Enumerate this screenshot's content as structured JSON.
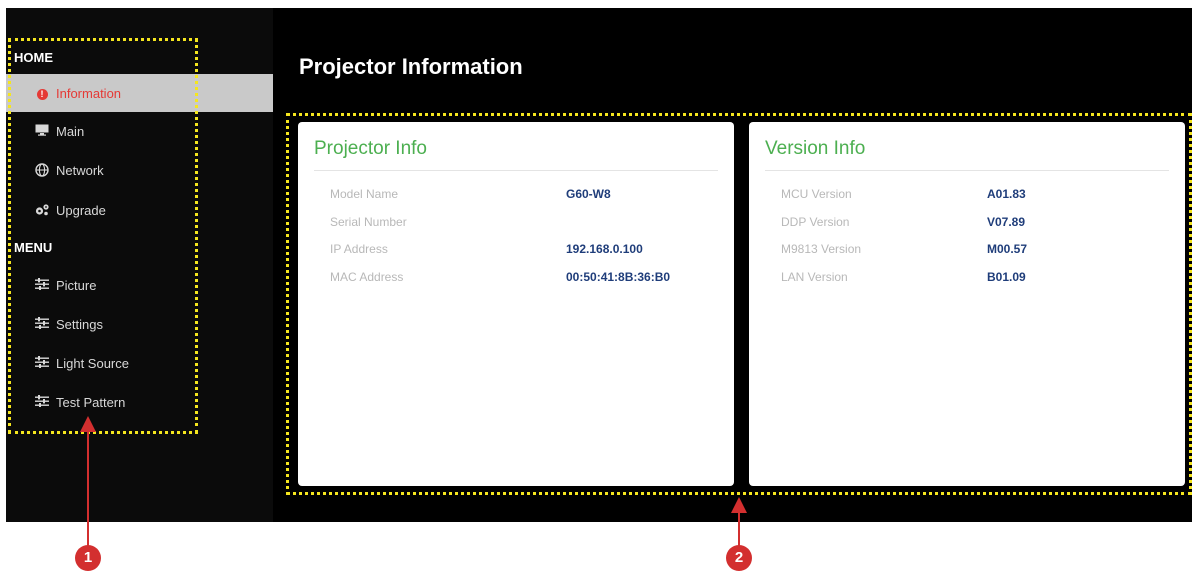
{
  "sidebar": {
    "home_label": "HOME",
    "home_items": [
      {
        "label": "Information",
        "icon": "info-icon",
        "active": true
      },
      {
        "label": "Main",
        "icon": "monitor-icon"
      },
      {
        "label": "Network",
        "icon": "network-icon"
      },
      {
        "label": "Upgrade",
        "icon": "gears-icon"
      }
    ],
    "menu_label": "MENU",
    "menu_items": [
      {
        "label": "Picture",
        "icon": "sliders-icon"
      },
      {
        "label": "Settings",
        "icon": "sliders-icon"
      },
      {
        "label": "Light Source",
        "icon": "sliders-icon"
      },
      {
        "label": "Test Pattern",
        "icon": "sliders-icon"
      }
    ]
  },
  "main": {
    "title": "Projector Information",
    "projector_card": {
      "title": "Projector Info",
      "rows": [
        {
          "label": "Model Name",
          "value": "G60-W8"
        },
        {
          "label": "Serial Number",
          "value": ""
        },
        {
          "label": "IP Address",
          "value": "192.168.0.100"
        },
        {
          "label": "MAC Address",
          "value": "00:50:41:8B:36:B0"
        }
      ]
    },
    "version_card": {
      "title": "Version Info",
      "rows": [
        {
          "label": "MCU Version",
          "value": "A01.83"
        },
        {
          "label": "DDP Version",
          "value": "V07.89"
        },
        {
          "label": "M9813 Version",
          "value": "M00.57"
        },
        {
          "label": "LAN Version",
          "value": "B01.09"
        }
      ]
    }
  },
  "callouts": {
    "one": "1",
    "two": "2"
  },
  "colors": {
    "accent_green": "#4caf50",
    "active_red": "#e53935",
    "value_blue": "#1f3d7a",
    "highlight_yellow": "#f5e61e",
    "callout_red": "#d32f2f"
  }
}
